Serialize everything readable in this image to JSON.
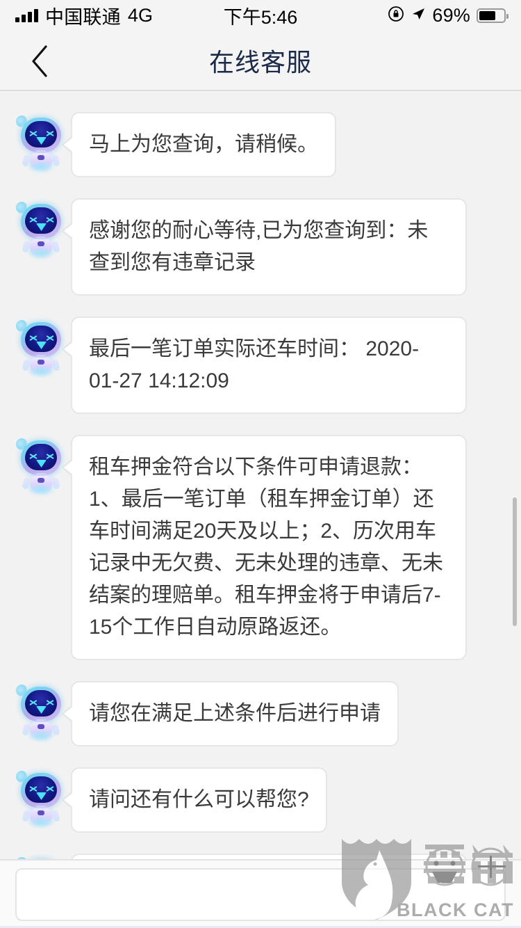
{
  "status_bar": {
    "carrier": "中国联通",
    "network": "4G",
    "time": "下午5:46",
    "battery_percent": "69%",
    "battery_level": 69,
    "icons": [
      "signal-icon",
      "lock-rotation-icon",
      "location-arrow-icon",
      "battery-icon"
    ]
  },
  "header": {
    "back_icon": "chevron-left-icon",
    "title": "在线客服",
    "title_color": "#1b2a49"
  },
  "chat": {
    "background_color": "#f2f2f2",
    "bubble_color": "#ffffff",
    "bubble_border_color": "#e6e6e6",
    "text_color": "#3a3a3a",
    "messages": [
      {
        "sender": "bot",
        "avatar": "robot-avatar",
        "text": "马上为您查询，请稍候。"
      },
      {
        "sender": "bot",
        "avatar": "robot-avatar",
        "text": "感谢您的耐心等待,已为您查询到：未查到您有违章记录"
      },
      {
        "sender": "bot",
        "avatar": "robot-avatar",
        "text": "最后一笔订单实际还车时间： 2020-01-27 14:12:09"
      },
      {
        "sender": "bot",
        "avatar": "robot-avatar",
        "text": "租车押金符合以下条件可申请退款：1、最后一笔订单（租车押金订单）还车时间满足20天及以上；2、历次用车记录中无欠费、无未处理的违章、无未结案的理赔单。租车押金将于申请后7-15个工作日自动原路返还。"
      },
      {
        "sender": "bot",
        "avatar": "robot-avatar",
        "text": "请您在满足上述条件后进行申请"
      },
      {
        "sender": "bot",
        "avatar": "robot-avatar",
        "text": "请问还有什么可以帮您?"
      },
      {
        "sender": "bot",
        "avatar": "robot-avatar",
        "text": ""
      }
    ]
  },
  "input_bar": {
    "value": "",
    "placeholder": ""
  },
  "watermark": {
    "label": "BLACK CAT",
    "logo_name": "black-cat-shield-logo",
    "color": "#7a7a7a"
  }
}
